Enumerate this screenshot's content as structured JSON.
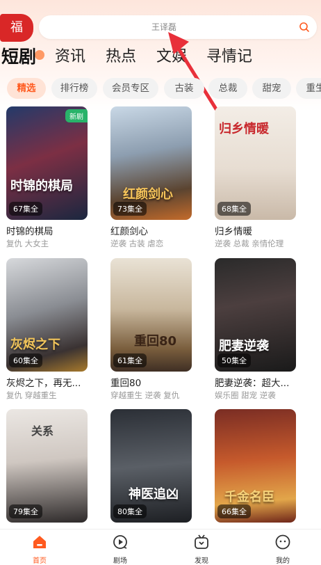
{
  "search": {
    "text": "王译磊"
  },
  "logo": {
    "text": "福"
  },
  "tabs": [
    "短剧",
    "资讯",
    "热点",
    "文娱",
    "寻情记"
  ],
  "chips": [
    "精选",
    "排行榜",
    "会员专区",
    "古装",
    "总裁",
    "甜宠",
    "重生"
  ],
  "dramas": [
    {
      "poster_text": "时锦的棋局",
      "badge": "新剧",
      "episodes": "67集全",
      "title": "时锦的棋局",
      "tags": "复仇 大女主"
    },
    {
      "poster_text": "红颜剑心",
      "badge": "",
      "episodes": "73集全",
      "title": "红颜剑心",
      "tags": "逆袭 古装 虐恋"
    },
    {
      "poster_text": "归乡情暖",
      "badge": "",
      "episodes": "68集全",
      "title": "归乡情暖",
      "tags": "逆袭 总裁 亲情伦理"
    },
    {
      "poster_text": "灰烬之下",
      "badge": "",
      "episodes": "60集全",
      "title": "灰烬之下，再无...",
      "tags": "复仇 穿越重生"
    },
    {
      "poster_text": "重回80",
      "badge": "",
      "episodes": "61集全",
      "title": "重回80",
      "tags": "穿越重生 逆袭 复仇"
    },
    {
      "poster_text": "肥妻逆袭",
      "badge": "",
      "episodes": "50集全",
      "title": "肥妻逆袭：超大...",
      "tags": "娱乐圈 甜宠 逆袭"
    },
    {
      "poster_text": "关系",
      "badge": "",
      "episodes": "79集全",
      "title": "",
      "tags": ""
    },
    {
      "poster_text": "神医追凶",
      "badge": "",
      "episodes": "80集全",
      "title": "",
      "tags": ""
    },
    {
      "poster_text": "千金名臣",
      "badge": "",
      "episodes": "66集全",
      "title": "",
      "tags": ""
    }
  ],
  "bottom_nav": [
    {
      "label": "首页",
      "icon": "home-icon"
    },
    {
      "label": "剧场",
      "icon": "theater-icon"
    },
    {
      "label": "发现",
      "icon": "discover-icon"
    },
    {
      "label": "我的",
      "icon": "profile-icon"
    }
  ],
  "colors": {
    "accent": "#ff5a1f",
    "logo_red": "#d92727",
    "arrow_red": "#e8303a"
  }
}
